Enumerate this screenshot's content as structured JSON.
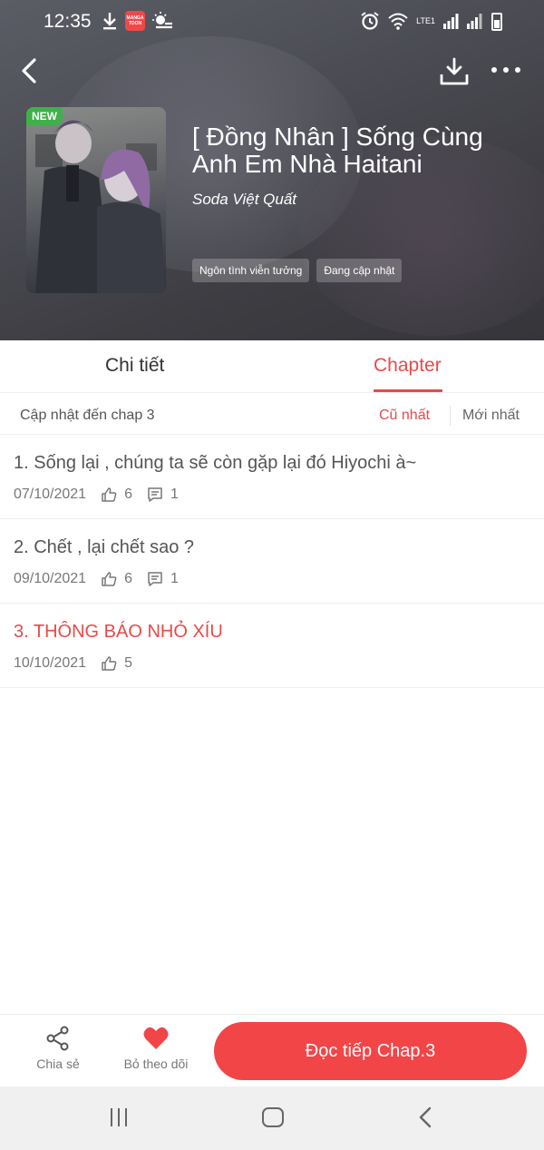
{
  "status_bar": {
    "time": "12:35",
    "app_logo_text": "MANGA TOON",
    "network_label": "LTE1"
  },
  "header": {
    "new_badge": "NEW",
    "title": "[ Đồng Nhân ] Sống Cùng Anh Em Nhà Haitani",
    "author": "Soda Việt Quất",
    "tags": [
      "Ngôn tình viễn tưởng",
      "Đang cập nhật"
    ]
  },
  "tabs": {
    "detail": "Chi tiết",
    "chapter": "Chapter",
    "active": "chapter"
  },
  "sort": {
    "update_text": "Cập nhật đến chap 3",
    "oldest": "Cũ nhất",
    "newest": "Mới nhất",
    "active": "oldest"
  },
  "chapters": [
    {
      "title": "1. Sống lại , chúng ta sẽ còn gặp lại đó Hiyochi à~",
      "date": "07/10/2021",
      "likes": "6",
      "comments": "1"
    },
    {
      "title": "2. Chết , lại chết sao ?",
      "date": "09/10/2021",
      "likes": "6",
      "comments": "1"
    },
    {
      "title": "3. THÔNG BÁO NHỎ XÍU",
      "date": "10/10/2021",
      "likes": "5",
      "highlight": true
    }
  ],
  "bottom_bar": {
    "share_label": "Chia sẻ",
    "follow_label": "Bỏ theo dõi",
    "read_button": "Đọc tiếp Chap.3"
  },
  "colors": {
    "accent": "#e84a4a",
    "button": "#f24547",
    "new_badge": "#3fb04a"
  },
  "icons": [
    "back-arrow-icon",
    "download-icon",
    "more-icon",
    "thumb-up-icon",
    "comment-icon",
    "share-icon",
    "heart-icon"
  ]
}
